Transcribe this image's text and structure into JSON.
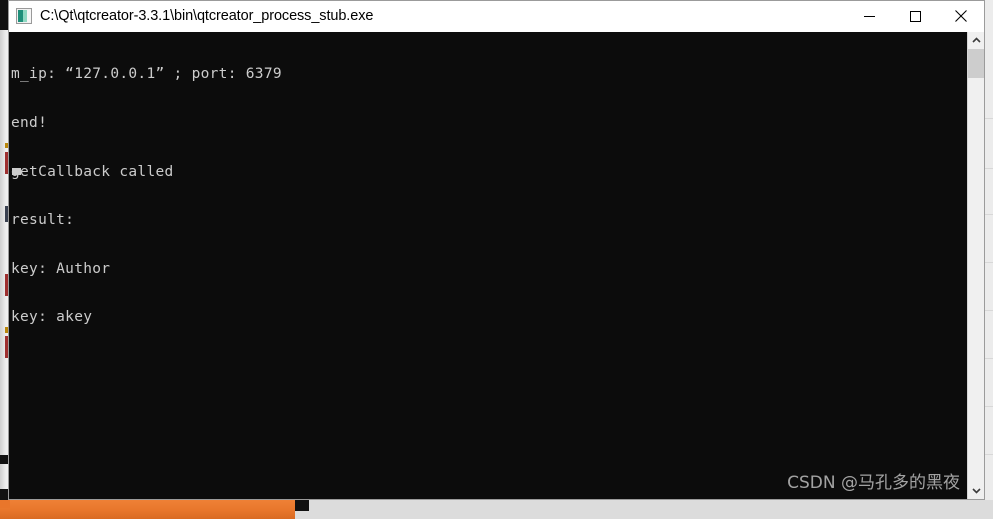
{
  "window": {
    "title": "C:\\Qt\\qtcreator-3.3.1\\bin\\qtcreator_process_stub.exe",
    "icon": "console-app-icon",
    "controls": {
      "minimize_label": "Minimize",
      "maximize_label": "Maximize",
      "close_label": "Close"
    }
  },
  "console": {
    "lines": [
      "m_ip: “127.0.0.1” ; port: 6379",
      "end!",
      "getCallback called",
      "result:",
      "key: Author",
      "key: akey"
    ],
    "cursor": "block-cursor",
    "background_color": "#0c0c0c",
    "text_color": "#cccccc"
  },
  "scrollbar": {
    "up_arrow": "chevron-up-icon",
    "down_arrow": "chevron-down-icon",
    "thumb": "scrollbar-thumb"
  },
  "watermark": {
    "text": "CSDN @马孔多的黑夜"
  },
  "desktop": {
    "accent_color": "#e8762b"
  }
}
